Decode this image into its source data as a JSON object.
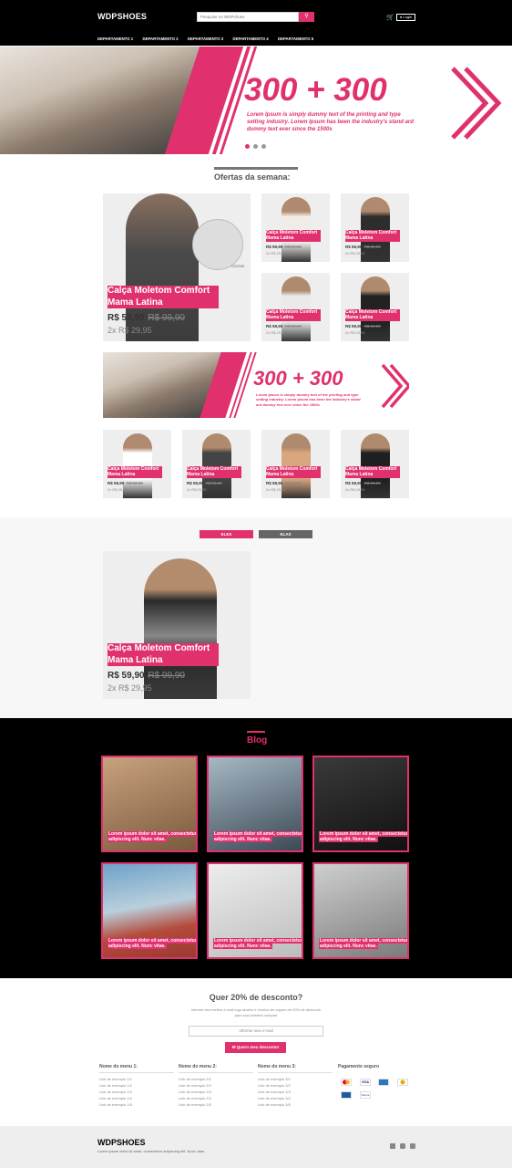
{
  "header": {
    "logo": "WDPSHOES",
    "search_placeholder": "Pesquise no WDPshoes",
    "search_icon": "search-icon",
    "cart_icon": "cart-icon",
    "login_label": "Login",
    "nav": [
      "DEPARTAMENTO 1",
      "DEPARTAMENTO 2",
      "DEPARTAMENTO 3",
      "DEPARTAMENTO 4",
      "DEPARTAMENTO 5"
    ]
  },
  "hero": {
    "headline": "300 + 300",
    "text": "Lorem Ipsum is simply dummy text of the printing and type setting industry. Lorem Ipsum has been the industry's stand ard dummy text ever since the 1500s",
    "slides": 3,
    "active_slide": 1
  },
  "offers": {
    "title": "Ofertas da semana:",
    "featured": {
      "name": "Calça Moletom Comfort Mama Latina",
      "price": "R$ 59,90",
      "old_price": "R$ 99,90",
      "installments": "2x R$ 29,95",
      "brand": "COSTAS"
    },
    "small_name": "Calça Moletom Comfort Mama Latina",
    "small_price": "R$ 59,90",
    "small_old": "R$ 99,90",
    "small_inst": "2x R$ 29,95"
  },
  "banner": {
    "headline": "300 + 300",
    "text": "Lorem Ipsum is simply dummy text of the printing and type setting industry. Lorem Ipsum has been the industry's stand ard dummy text ever since the 1500s"
  },
  "gender_tabs": {
    "active": "ELES",
    "inactive": "ELAS"
  },
  "blog": {
    "title": "Blog",
    "caption": "Lorem ipsum dolor sit amet, consectetur adipiscing elit. Nunc vitae."
  },
  "newsletter": {
    "title": "Quer 20% de desconto?",
    "text": "Informe seu melhor e-mail logo abaixo e receba um cupom de 20% de desconto para sua primeira compra!",
    "email_placeholder": "Informe seu e-mail",
    "button": "Quero meu desconto!"
  },
  "footer_menus": [
    {
      "title": "Nome do menu 1:",
      "links": [
        "Link de exemplo 1/1",
        "Link de exemplo 1/2",
        "Link de exemplo 1/3",
        "Link de exemplo 1/4",
        "Link de exemplo 1/5"
      ]
    },
    {
      "title": "Nome do menu 2:",
      "links": [
        "Link de exemplo 2/1",
        "Link de exemplo 2/2",
        "Link de exemplo 2/3",
        "Link de exemplo 2/4",
        "Link de exemplo 2/5"
      ]
    },
    {
      "title": "Nome do menu 3:",
      "links": [
        "Link de exemplo 3/1",
        "Link de exemplo 3/2",
        "Link de exemplo 3/3",
        "Link de exemplo 3/4",
        "Link de exemplo 3/5"
      ]
    }
  ],
  "payment": {
    "title": "Pagamento seguro",
    "icons": [
      "mastercard-icon",
      "visa-icon",
      "amex-icon",
      "hipercard-icon",
      "elo-icon",
      "diners-icon"
    ]
  },
  "footer": {
    "logo": "WDPSHOES",
    "tagline": "Lorem ipsum dolor sit amet, consectetur adipiscing elit. Nunc vitae.",
    "social_icons": [
      "facebook-icon",
      "instagram-icon",
      "youtube-icon"
    ]
  }
}
